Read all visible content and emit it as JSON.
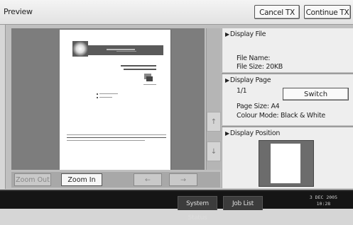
{
  "header": {
    "title": "Preview",
    "cancel_tx_label": "Cancel TX",
    "continue_tx_label": "Continue TX"
  },
  "preview": {
    "zoom_out_label": "Zoom Out",
    "zoom_in_label": "Zoom In",
    "arrow_left": "←",
    "arrow_right": "→",
    "scroll_up": "↑",
    "scroll_down": "↓",
    "document_logo_icon": "document-logo-icon"
  },
  "panel": {
    "display_file": {
      "heading": "Display File",
      "file_name_label": "File Name:",
      "file_size_label": "File Size: 20KB"
    },
    "display_page": {
      "heading": "Display Page",
      "page_counter": "1/1",
      "switch_label": "Switch",
      "page_size_label": "Page Size: A4",
      "colour_mode_label": "Colour Mode: Black & White"
    },
    "display_position": {
      "heading": "Display Position"
    }
  },
  "statusbar": {
    "system_status_label": "System Status",
    "job_list_label": "Job List",
    "date": "3 DEC  2005",
    "time": "10:28"
  }
}
